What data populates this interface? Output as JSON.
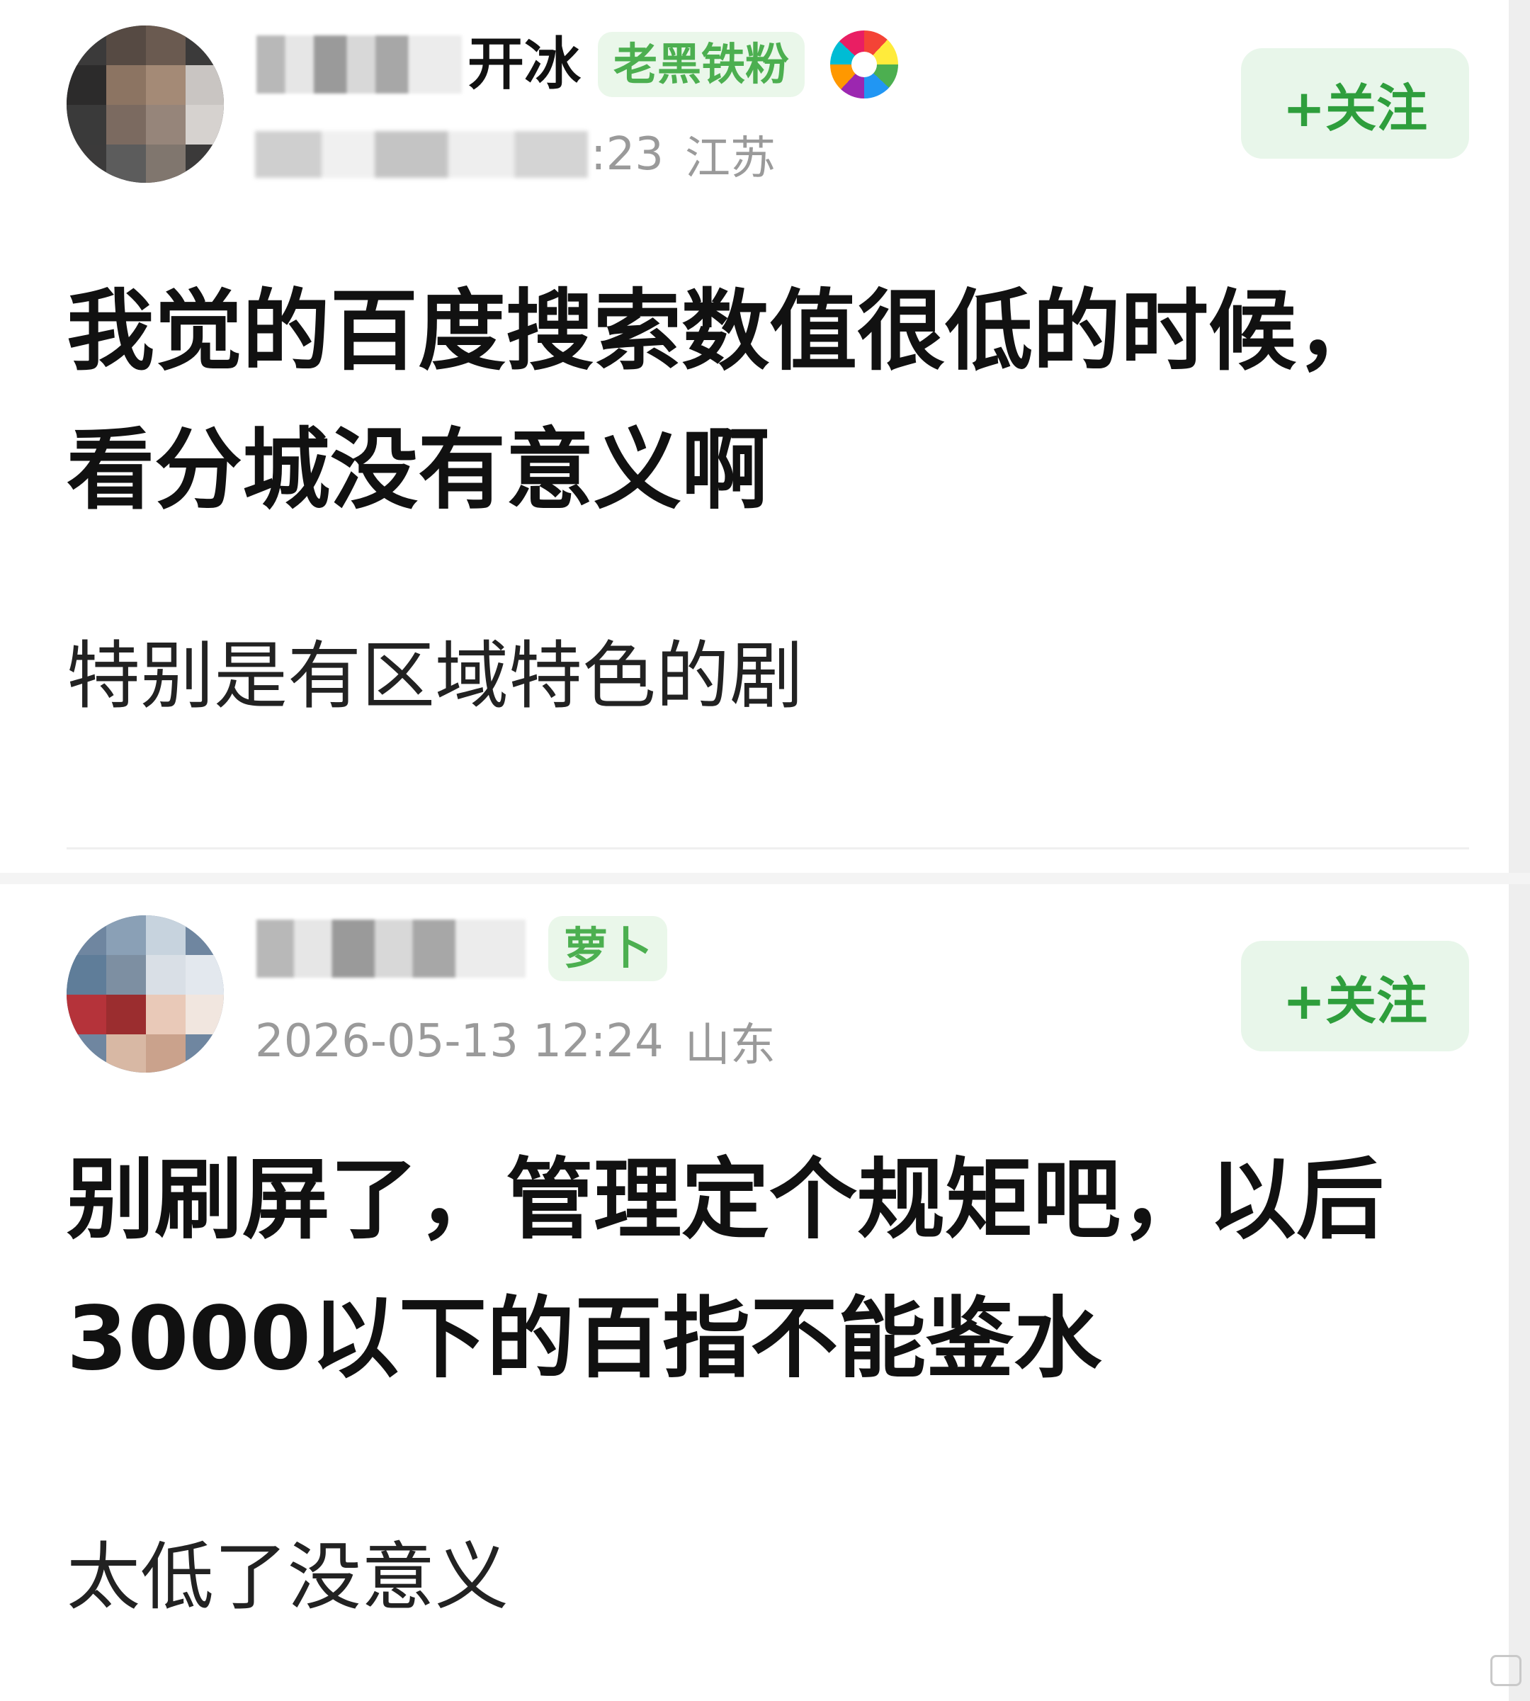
{
  "posts": [
    {
      "username_visible": "开冰",
      "fan_badge": "老黑铁粉",
      "time_visible": ":23",
      "location": "江苏",
      "follow_label": "+关注",
      "title": "我觉的百度搜索数值很低的时候，看分城没有意义啊",
      "body": "特别是有区域特色的剧"
    },
    {
      "username_visible": "",
      "fan_badge": "萝卜",
      "time": "2026-05-13 12:24",
      "location": "山东",
      "follow_label": "+关注",
      "title": "别刷屏了，管理定个规矩吧，以后3000以下的百指不能鉴水",
      "body": "太低了没意义"
    }
  ],
  "colors": {
    "badge_green": "#4caf50",
    "follow_green": "#2e9e3c",
    "follow_bg": "#e8f6ea",
    "meta_gray": "#9a9a9a"
  },
  "icons": {
    "medal": "rainbow-medal-icon"
  }
}
